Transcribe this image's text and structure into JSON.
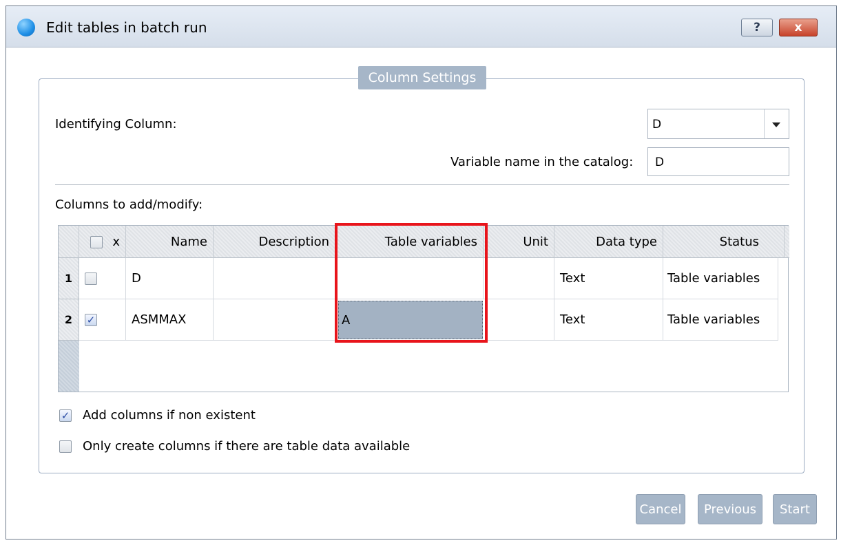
{
  "window": {
    "title": "Edit tables in batch run",
    "help_label": "?",
    "close_label": "x"
  },
  "section": {
    "legend": "Column Settings"
  },
  "identifying": {
    "label": "Identifying Column:",
    "value": "D"
  },
  "catalog": {
    "label": "Variable name in the catalog:",
    "value": "D"
  },
  "columns_label": "Columns to add/modify:",
  "table": {
    "headers": [
      "x",
      "Name",
      "Description",
      "Table variables",
      "Unit",
      "Data type",
      "Status"
    ],
    "rows": [
      {
        "num": "1",
        "checked": false,
        "name": "D",
        "description": "",
        "table_variables": "",
        "unit": "",
        "data_type": "Text",
        "status": "Table variables"
      },
      {
        "num": "2",
        "checked": true,
        "name": "ASMMAX",
        "description": "",
        "table_variables": "A",
        "unit": "",
        "data_type": "Text",
        "status": "Table variables"
      }
    ]
  },
  "options": {
    "add_columns": {
      "label": "Add columns if non existent",
      "checked": true
    },
    "only_create": {
      "label": "Only create columns if there are table data available",
      "checked": false
    }
  },
  "buttons": {
    "cancel": "Cancel",
    "previous": "Previous",
    "start": "Start"
  },
  "colors": {
    "highlight": "#e8141b",
    "disabled_button": "#a6b6c8",
    "selected_cell": "#a3b2c3"
  }
}
